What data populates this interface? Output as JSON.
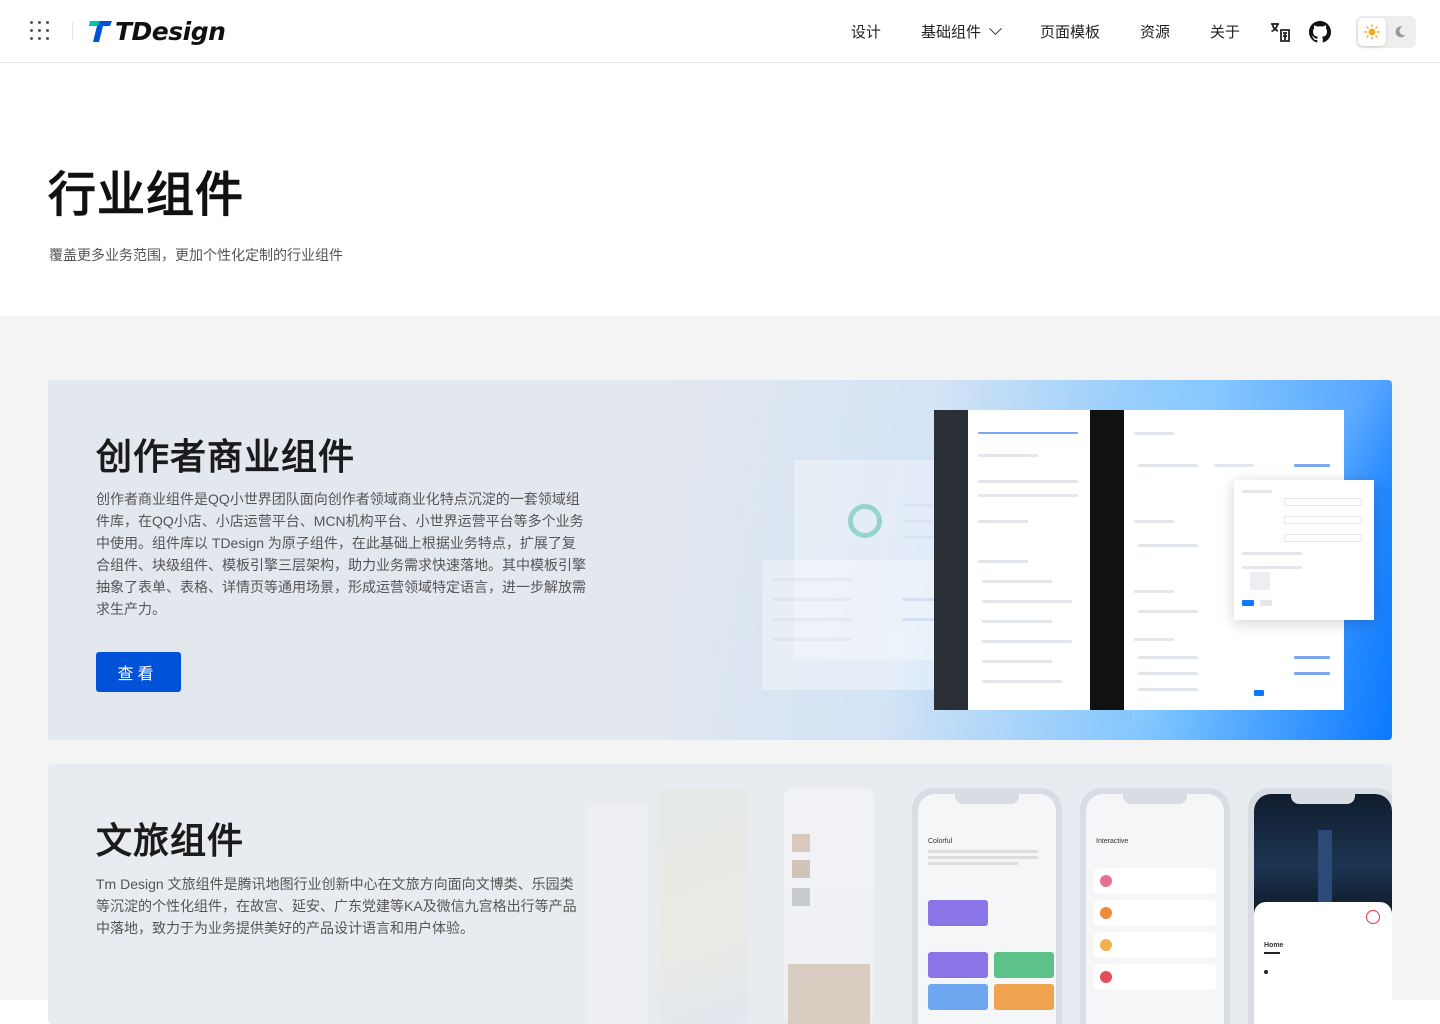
{
  "header": {
    "logo_text": "TDesign",
    "nav": [
      {
        "label": "设计"
      },
      {
        "label": "基础组件"
      },
      {
        "label": "页面模板"
      },
      {
        "label": "资源"
      },
      {
        "label": "关于"
      }
    ]
  },
  "hero": {
    "title": "行业组件",
    "subtitle": "覆盖更多业务范围，更加个性化定制的行业组件"
  },
  "cards": [
    {
      "title": "创作者商业组件",
      "description": "创作者商业组件是QQ小世界团队面向创作者领域商业化特点沉淀的一套领域组件库，在QQ小店、小店运营平台、MCN机构平台、小世界运营平台等多个业务中使用。组件库以 TDesign 为原子组件，在此基础上根据业务特点，扩展了复合组件、块级组件、模板引擎三层架构，助力业务需求快速落地。其中模板引擎抽象了表单、表格、详情页等通用场景，形成运营领域特定语言，进一步解放需求生产力。",
      "button": "查看"
    },
    {
      "title": "文旅组件",
      "description": "Tm Design 文旅组件是腾讯地图行业创新中心在文旅方向面向文博类、乐园类等沉淀的个性化组件，在故宫、延安、广东党建等KA及微信九宫格出行等产品中落地，致力于为业务提供美好的产品设计语言和用户体验。"
    }
  ],
  "colors": {
    "brand": "#0052d9",
    "page_bg": "#f4f4f4",
    "card_bg": "#e3e7ee"
  }
}
